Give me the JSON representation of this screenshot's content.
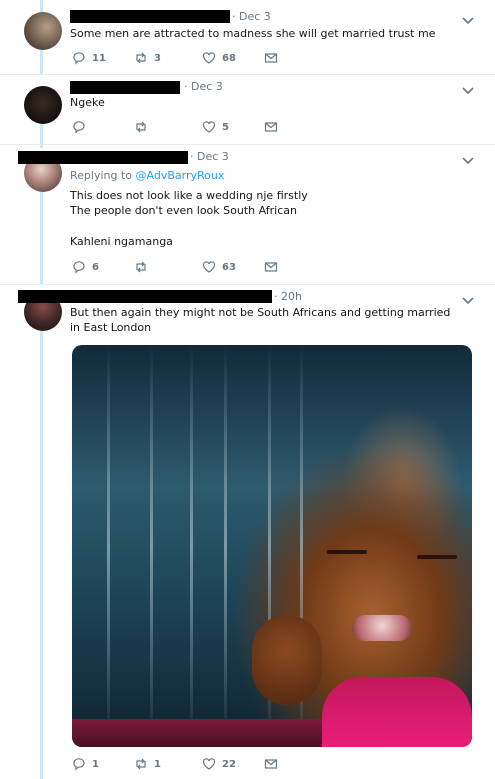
{
  "colors": {
    "accent": "#1da1f2",
    "thread_line": "#cce7f7",
    "muted": "#657786",
    "text": "#14171a"
  },
  "tweets": [
    {
      "date": "· Dec 3",
      "text": "Some men are attracted to madness she will get married  trust me",
      "replies": "11",
      "retweets": "3",
      "likes": "68"
    },
    {
      "date": "· Dec 3",
      "text": "Ngeke",
      "replies": "",
      "retweets": "",
      "likes": "5"
    },
    {
      "date": "· Dec 3",
      "replying_label": "Replying to",
      "replying_handle": "@AdvBarryRoux",
      "text_line1": "This does not look like a wedding nje firstly",
      "text_line2": "The people don't even look South African",
      "text_line3": "Kahleni ngamanga",
      "replies": "6",
      "retweets": "",
      "likes": "63"
    },
    {
      "date": "· 20h",
      "text": "But then again they might not be South Africans and getting married in East London",
      "replies": "1",
      "retweets": "1",
      "likes": "22"
    }
  ],
  "icons": {
    "reply": "reply-icon",
    "retweet": "retweet-icon",
    "like": "heart-icon",
    "dm": "envelope-icon",
    "more": "chevron-down-icon"
  }
}
